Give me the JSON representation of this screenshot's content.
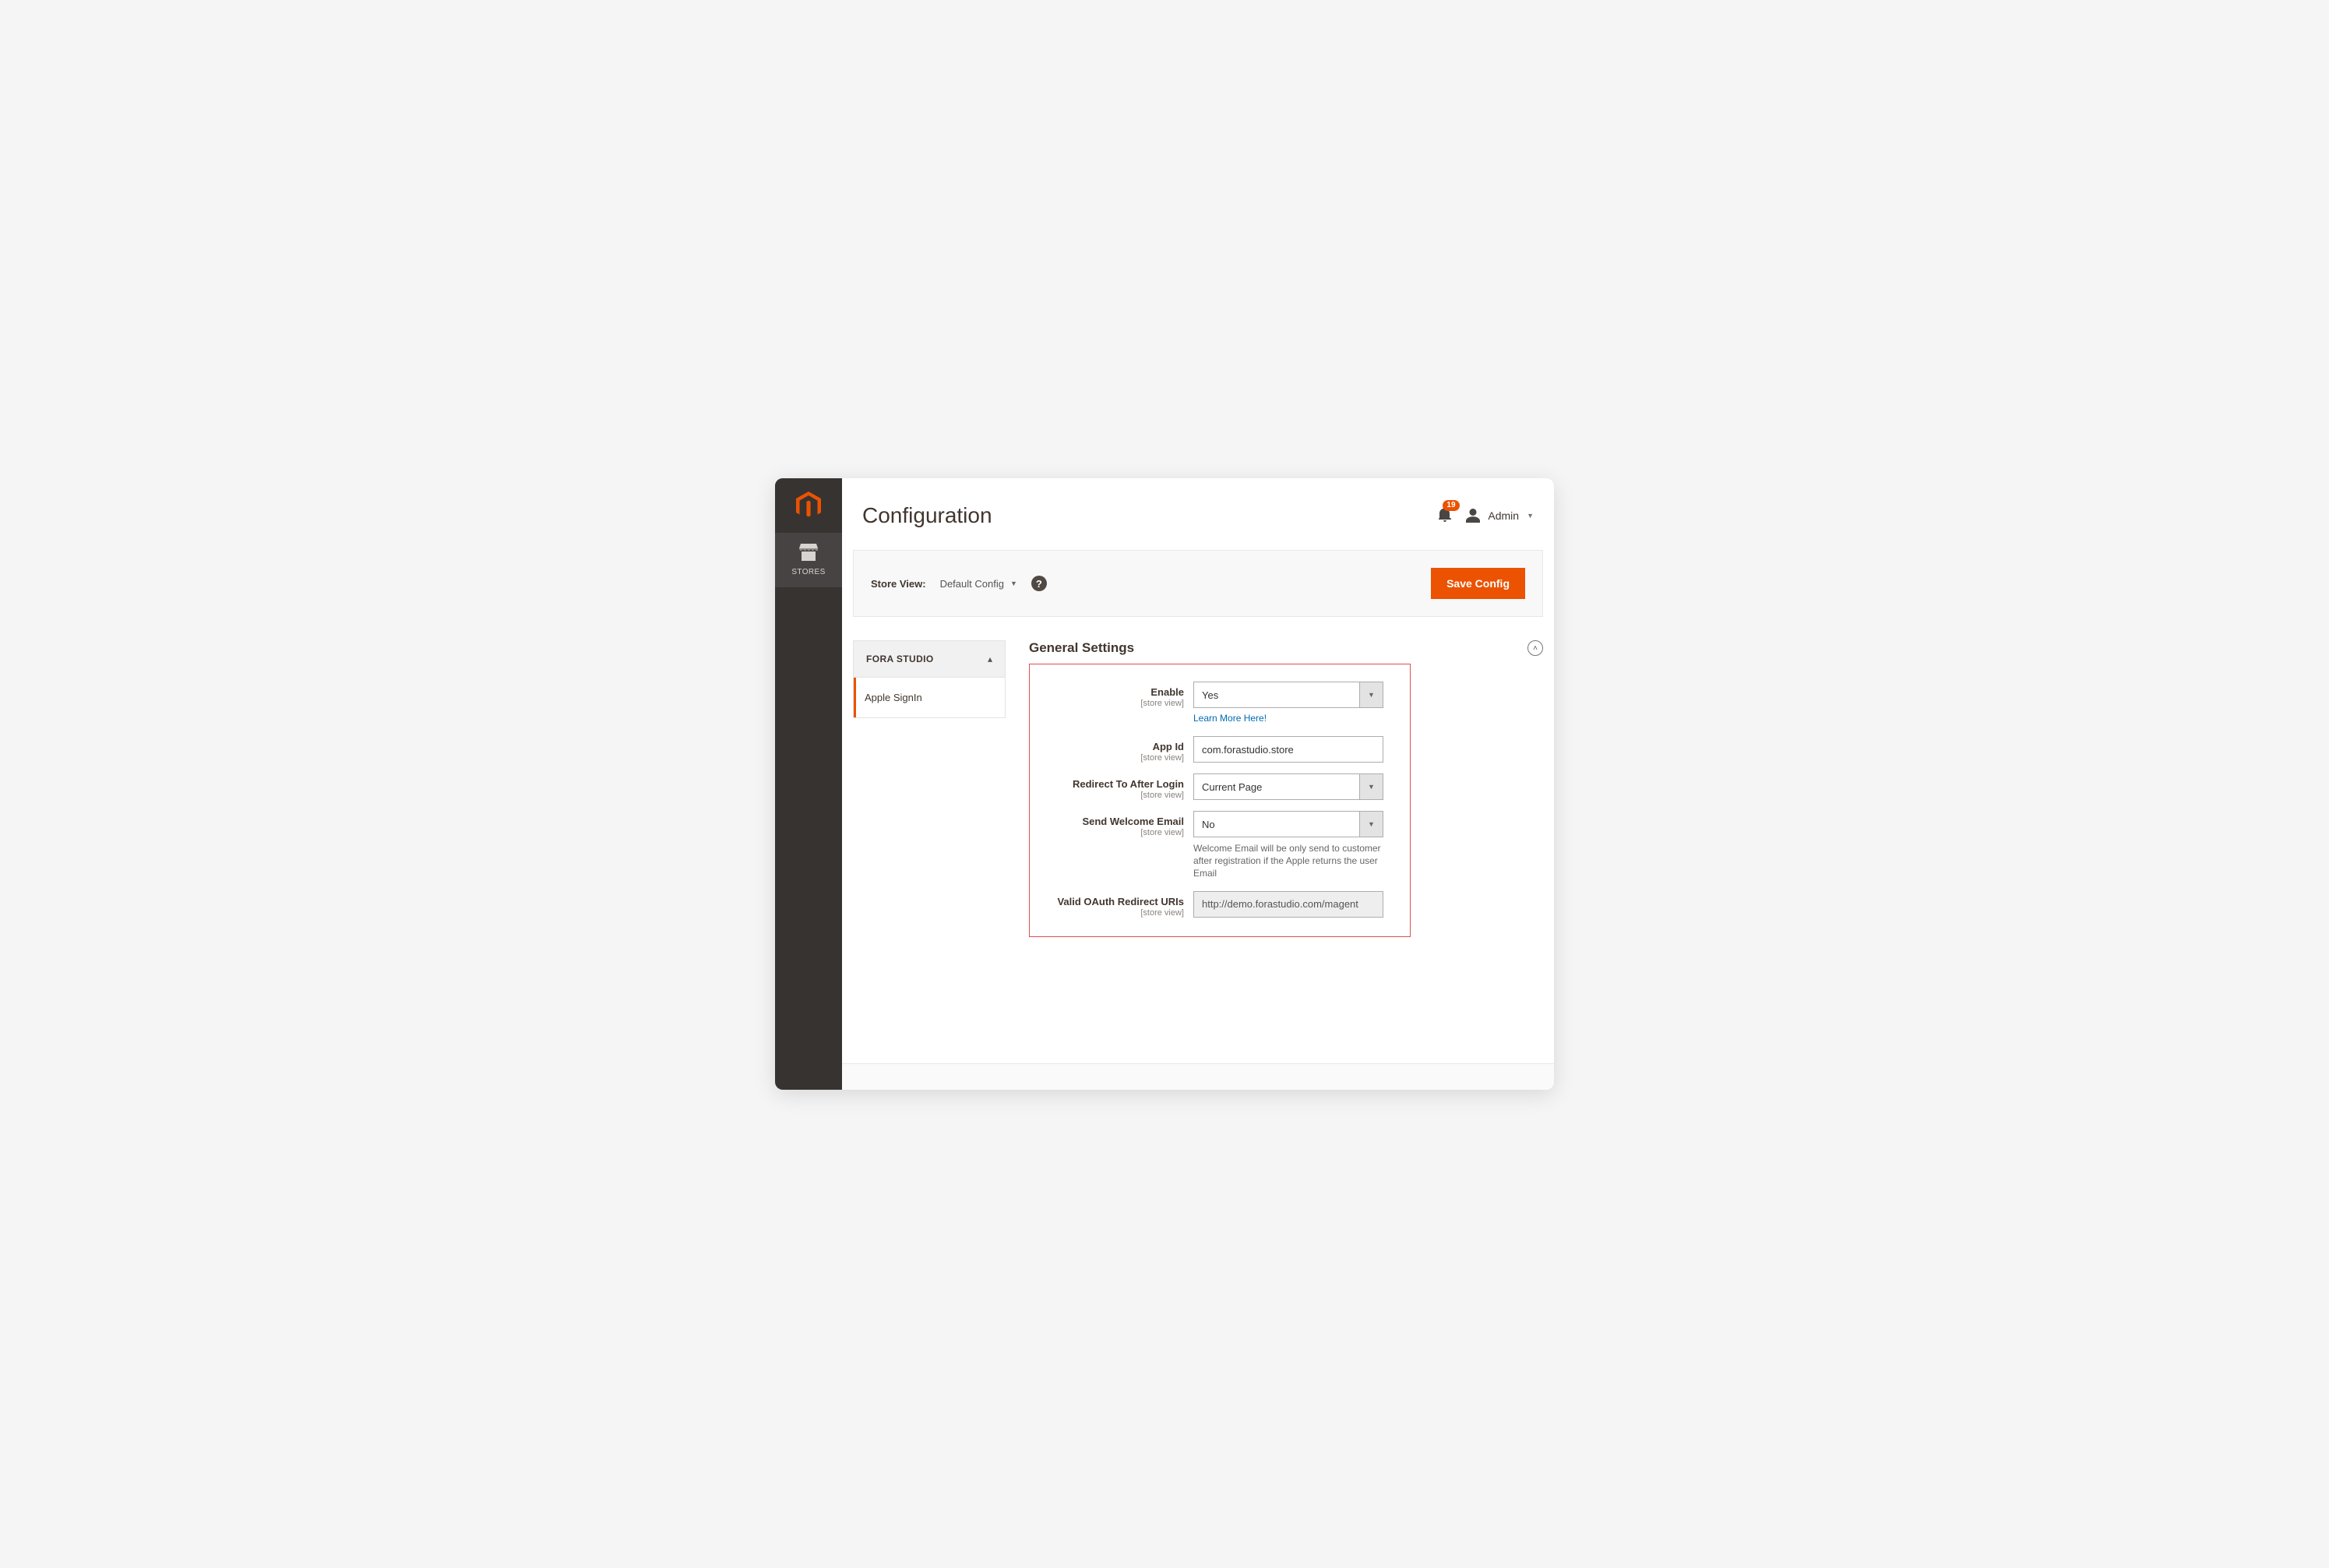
{
  "header": {
    "title": "Configuration",
    "notifications_count": "19",
    "user_label": "Admin"
  },
  "sidebar": {
    "items": [
      {
        "label": "STORES"
      }
    ]
  },
  "scope_bar": {
    "label": "Store View:",
    "value": "Default Config",
    "save_label": "Save Config"
  },
  "config_nav": {
    "group_title": "FORA STUDIO",
    "tabs": [
      {
        "label": "Apple SignIn"
      }
    ]
  },
  "section": {
    "title": "General Settings",
    "scope_note": "[store view]",
    "fields": {
      "enable": {
        "label": "Enable",
        "value": "Yes",
        "link": "Learn More Here!"
      },
      "app_id": {
        "label": "App Id",
        "value": "com.forastudio.store"
      },
      "redirect": {
        "label": "Redirect To After Login",
        "value": "Current Page"
      },
      "welcome_email": {
        "label": "Send Welcome Email",
        "value": "No",
        "hint": "Welcome Email will be only send to customer after registration if the Apple returns the user Email"
      },
      "redirect_uris": {
        "label": "Valid OAuth Redirect URIs",
        "value": "http://demo.forastudio.com/magent"
      }
    }
  }
}
